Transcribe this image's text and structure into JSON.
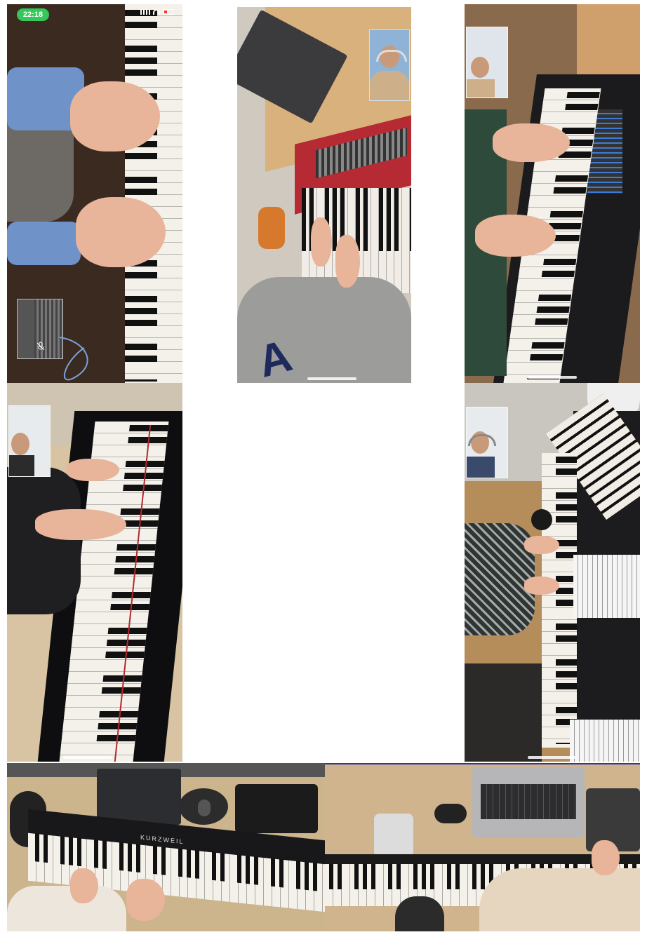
{
  "status_bar": {
    "time": "22:18",
    "icons": [
      "signal-icon",
      "wifi-icon",
      "battery-icon"
    ]
  },
  "tiles": [
    {
      "id": "tile-1",
      "description_icon": "upright-piano-hands",
      "pip": "self-view-muted"
    },
    {
      "id": "tile-2",
      "description_icon": "red-stage-piano",
      "pip": "student-with-headphones"
    },
    {
      "id": "tile-3",
      "description_icon": "black-synth-keyboard",
      "pip": "student-with-headphones"
    },
    {
      "id": "tile-4",
      "description_icon": "grand-piano",
      "pip": "student-with-headphones"
    },
    {
      "id": "tile-5",
      "description_icon": "keyboard-with-microphone",
      "pip": "student-with-headphones"
    },
    {
      "id": "tile-6",
      "description_icon": "kurzweil-keyboard"
    },
    {
      "id": "tile-7",
      "description_icon": "keyboard-with-laptop"
    }
  ],
  "colors": {
    "status_green": "#34c759",
    "battery_red": "#ff3b30",
    "stage_piano_red": "#b52a33"
  },
  "keyboard_brand": "KURZWEIL"
}
